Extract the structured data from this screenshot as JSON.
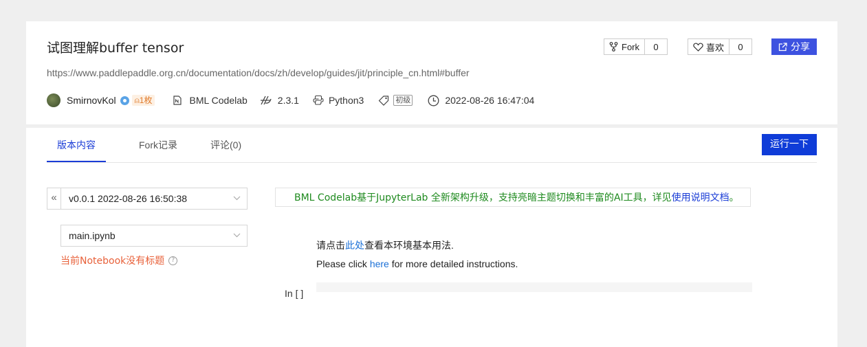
{
  "header": {
    "title": "试图理解buffer tensor",
    "url": "https://www.paddlepaddle.org.cn/documentation/docs/zh/develop/guides/jit/principle_cn.html#buffer",
    "author": "SmirnovKol",
    "coin_badge": "1枚",
    "platform": "BML Codelab",
    "framework_version": "2.3.1",
    "language": "Python3",
    "level": "初级",
    "datetime": "2022-08-26 16:47:04",
    "fork_label": "Fork",
    "fork_count": "0",
    "like_label": "喜欢",
    "like_count": "0",
    "share_label": "分享"
  },
  "tabs": [
    {
      "label": "版本内容",
      "active": true
    },
    {
      "label": "Fork记录",
      "active": false
    },
    {
      "label": "评论(0)",
      "active": false
    }
  ],
  "run_button": "运行一下",
  "version_select": {
    "collapse_glyph": "«",
    "value": "v0.0.1 2022-08-26 16:50:38"
  },
  "file_select": {
    "value": "main.ipynb"
  },
  "no_title_notice": "当前Notebook没有标题",
  "notice": {
    "text": "BML Codelab基于JupyterLab 全新架构升级，支持亮暗主题切换和丰富的AI工具，详见",
    "link": "使用说明文档",
    "suffix": "。"
  },
  "notebook": {
    "line1_prefix": "请点击",
    "line1_link": "此处",
    "line1_suffix": "查看本环境基本用法.",
    "line2_prefix": "Please click ",
    "line2_link": "here",
    "line2_suffix": " for more detailed instructions.",
    "cell_prompt": "In [ ]"
  },
  "colors": {
    "accent": "#0f3cd8",
    "share": "#3d52e0",
    "notice_text": "#1e8a1e",
    "warning": "#e8613a"
  }
}
